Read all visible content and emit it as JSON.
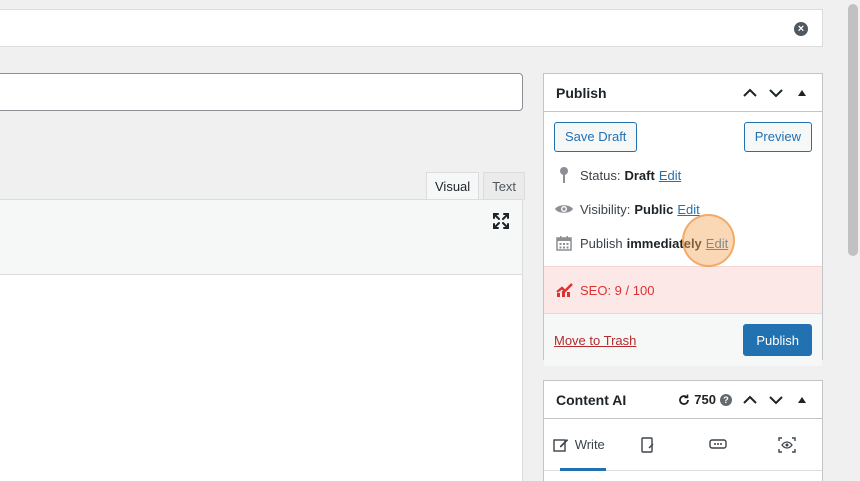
{
  "editor": {
    "tabs": [
      {
        "label": "Visual",
        "active": true
      },
      {
        "label": "Text",
        "active": false
      }
    ],
    "close_icon": "close-circle-icon",
    "expand_icon": "fullscreen-expand-icon"
  },
  "publish": {
    "title": "Publish",
    "save_draft": "Save Draft",
    "preview": "Preview",
    "status_label": "Status:",
    "status_value": "Draft",
    "visibility_label": "Visibility:",
    "visibility_value": "Public",
    "schedule_label": "Publish",
    "schedule_value": "immediately",
    "edit_link": "Edit",
    "seo_label": "SEO: 9 / 100",
    "trash": "Move to Trash",
    "publish_button": "Publish",
    "colors": {
      "primary": "#2271b1",
      "seo_bg": "#fde8e8",
      "seo_text": "#dc3232",
      "trash": "#b32d2e"
    }
  },
  "content_ai": {
    "title": "Content AI",
    "credits": "750",
    "tabs": [
      {
        "label": "Write",
        "icon": "pencil-square-icon",
        "active": true
      },
      {
        "label": "",
        "icon": "clipboard-icon",
        "active": false
      },
      {
        "label": "",
        "icon": "chat-dots-icon",
        "active": false
      },
      {
        "label": "",
        "icon": "eye-scan-icon",
        "active": false
      }
    ]
  }
}
